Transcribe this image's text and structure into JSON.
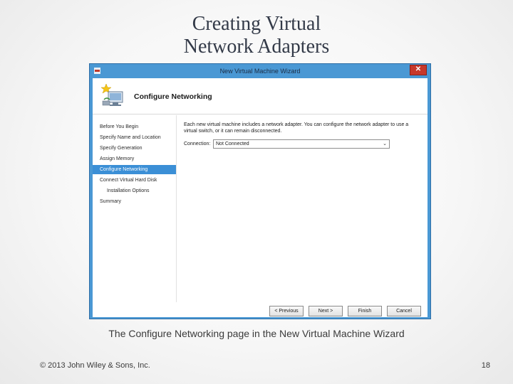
{
  "slide": {
    "title_line1": "Creating Virtual",
    "title_line2": "Network Adapters",
    "caption": "The Configure Networking page in the New Virtual Machine Wizard",
    "copyright": "© 2013 John Wiley & Sons, Inc.",
    "page_number": "18"
  },
  "window": {
    "title": "New Virtual Machine Wizard",
    "close_label": "✕",
    "page_heading": "Configure Networking",
    "nav_items": [
      {
        "label": "Before You Begin"
      },
      {
        "label": "Specify Name and Location"
      },
      {
        "label": "Specify Generation"
      },
      {
        "label": "Assign Memory"
      },
      {
        "label": "Configure Networking"
      },
      {
        "label": "Connect Virtual Hard Disk"
      },
      {
        "label": "Installation Options"
      },
      {
        "label": "Summary"
      }
    ],
    "active_nav_index": 4,
    "description": "Each new virtual machine includes a network adapter. You can configure the network adapter to use a virtual switch, or it can remain disconnected.",
    "connection_label": "Connection:",
    "connection_value": "Not Connected",
    "buttons": {
      "previous": "< Previous",
      "next": "Next >",
      "finish": "Finish",
      "cancel": "Cancel"
    }
  },
  "colors": {
    "window_frame": "#4a98d4",
    "selected_nav": "#3b8fd6",
    "close_button": "#c7382b"
  }
}
